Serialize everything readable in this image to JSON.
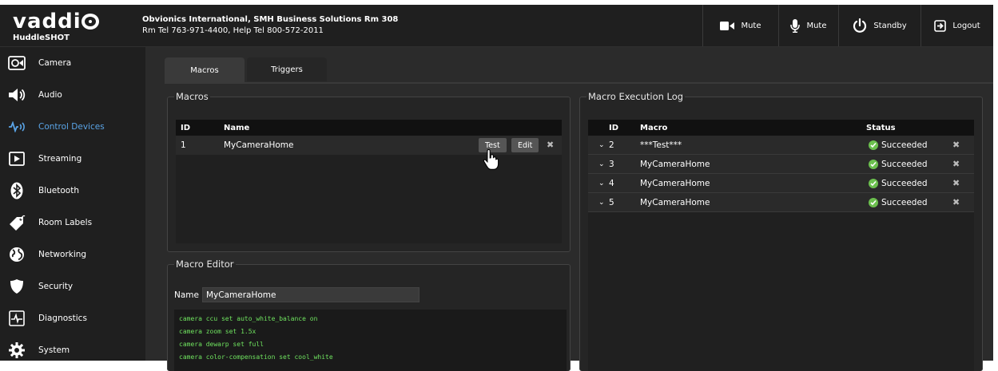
{
  "brand": {
    "logo_text": "vaddi",
    "product": "HuddleSHOT"
  },
  "org": {
    "line1": "Obvionics International, SMH Business Solutions Rm 308",
    "line2": "Rm Tel 763-971-4400, Help Tel 800-572-2011"
  },
  "header": {
    "video_mute_label": "Mute",
    "audio_mute_label": "Mute",
    "standby_label": "Standby",
    "logout_label": "Logout"
  },
  "sidebar": {
    "items": [
      {
        "label": "Camera",
        "icon": "camera-icon"
      },
      {
        "label": "Audio",
        "icon": "speaker-icon"
      },
      {
        "label": "Control Devices",
        "icon": "signal-icon",
        "active": true
      },
      {
        "label": "Streaming",
        "icon": "play-icon"
      },
      {
        "label": "Bluetooth",
        "icon": "bluetooth-icon"
      },
      {
        "label": "Room Labels",
        "icon": "tag-icon"
      },
      {
        "label": "Networking",
        "icon": "globe-icon"
      },
      {
        "label": "Security",
        "icon": "shield-icon"
      },
      {
        "label": "Diagnostics",
        "icon": "pulse-icon"
      },
      {
        "label": "System",
        "icon": "gear-icon"
      }
    ]
  },
  "tabs": [
    {
      "label": "Macros",
      "active": true
    },
    {
      "label": "Triggers",
      "active": false
    }
  ],
  "macros": {
    "title": "Macros",
    "columns": {
      "id": "ID",
      "name": "Name"
    },
    "rows": [
      {
        "id": "1",
        "name": "MyCameraHome"
      }
    ],
    "test_label": "Test",
    "edit_label": "Edit"
  },
  "editor": {
    "title": "Macro Editor",
    "name_label": "Name",
    "name_value": "MyCameraHome",
    "lines": [
      "camera ccu set auto_white_balance on",
      "camera zoom set 1.5x",
      "camera dewarp set full",
      "camera color-compensation set cool_white"
    ]
  },
  "log": {
    "title": "Macro Execution Log",
    "columns": {
      "id": "ID",
      "macro": "Macro",
      "status": "Status"
    },
    "rows": [
      {
        "id": "2",
        "macro": "***Test***",
        "status": "Succeeded"
      },
      {
        "id": "3",
        "macro": "MyCameraHome",
        "status": "Succeeded"
      },
      {
        "id": "4",
        "macro": "MyCameraHome",
        "status": "Succeeded"
      },
      {
        "id": "5",
        "macro": "MyCameraHome",
        "status": "Succeeded"
      }
    ]
  },
  "colors": {
    "background": "#2b2b2b",
    "header": "#1f1f1f",
    "active_nav": "#5aa4e6",
    "code_text": "#6fe35f",
    "success": "#6bbf4e"
  }
}
